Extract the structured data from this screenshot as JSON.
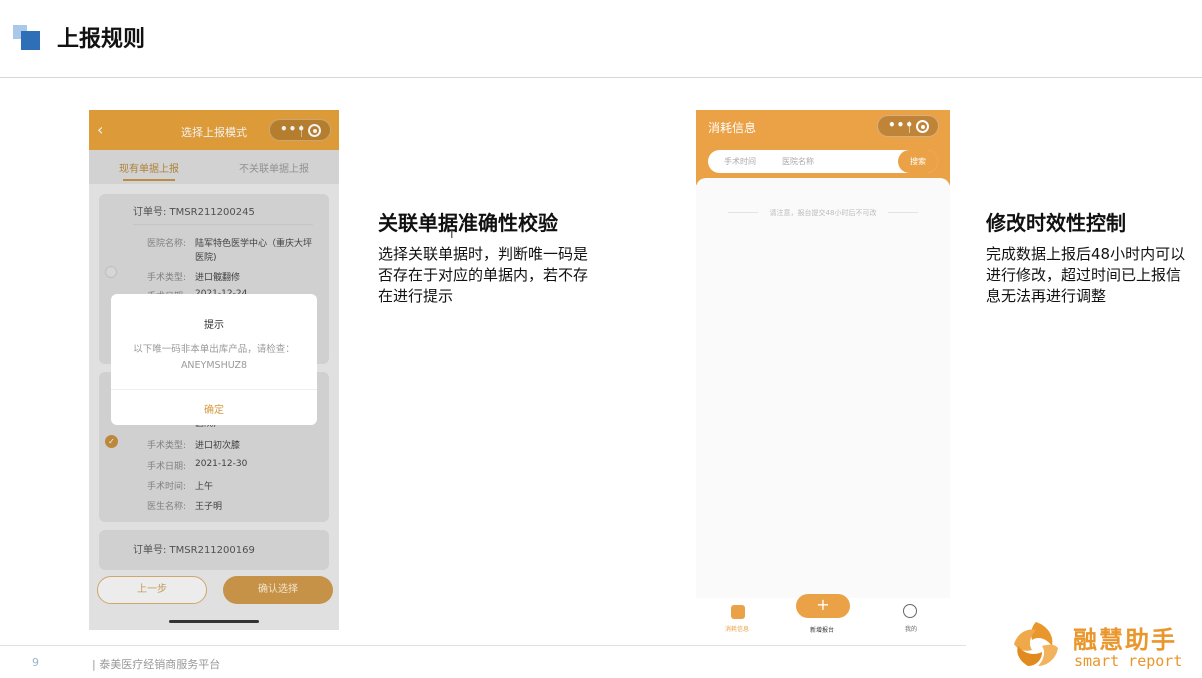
{
  "slide": {
    "title": "上报规则",
    "page_number": "9",
    "footer_text": "| 泰美医疗经销商服务平台"
  },
  "phone1": {
    "back_icon": "‹",
    "nav_title": "选择上报模式",
    "capsule_dots": "•••",
    "tabs": [
      "现有单据上报",
      "不关联单据上报"
    ],
    "order1": {
      "order_label": "订单号: TMSR211200245",
      "hospital_label": "医院名称:",
      "hospital_value": "陆军特色医学中心（重庆大坪",
      "hospital_value_2": "医院)",
      "type_label": "手术类型:",
      "type_value": "进口髋翻修",
      "date_label": "手术日期:",
      "date_value": "2021-12-24"
    },
    "order2": {
      "hospital_value_2": "医院)",
      "type_label": "手术类型:",
      "type_value": "进口初次膝",
      "date_label": "手术日期:",
      "date_value": "2021-12-30",
      "time_label": "手术时间:",
      "time_value": "上午",
      "doctor_label": "医生名称:",
      "doctor_value": "王子明"
    },
    "order3_label": "订单号: TMSR211200169",
    "dialog": {
      "title": "提示",
      "message": "以下唯一码非本单出库产品，请检查：ANEYMSHUZ8",
      "ok": "确定"
    },
    "btn_prev": "上一步",
    "btn_confirm": "确认选择",
    "check_glyph": "✓"
  },
  "section1": {
    "heading": "关联单据准确性校验",
    "description": "选择关联单据时，判断唯一码是否存在于对应的单据内，若不存在进行提示",
    "cursor": "I"
  },
  "phone2": {
    "title": "消耗信息",
    "capsule_dots": "•••",
    "search_time": "手术时间",
    "search_hospital": "医院名称",
    "search_btn": "搜索",
    "notice": "请注意，报台提交48小时后不可改",
    "tabbar": {
      "item1": "消耗信息",
      "plus": "+",
      "item2": "新增报台",
      "item3": "我的"
    }
  },
  "section2": {
    "heading": "修改时效性控制",
    "description": "完成数据上报后48小时内可以进行修改，超过时间已上报信息无法再进行调整"
  },
  "logo": {
    "cn": "融慧助手",
    "en": "smart report",
    "color": "#e9972c"
  },
  "colors": {
    "accent_blue": "#2e6fb7",
    "accent_orange": "#eba246"
  }
}
